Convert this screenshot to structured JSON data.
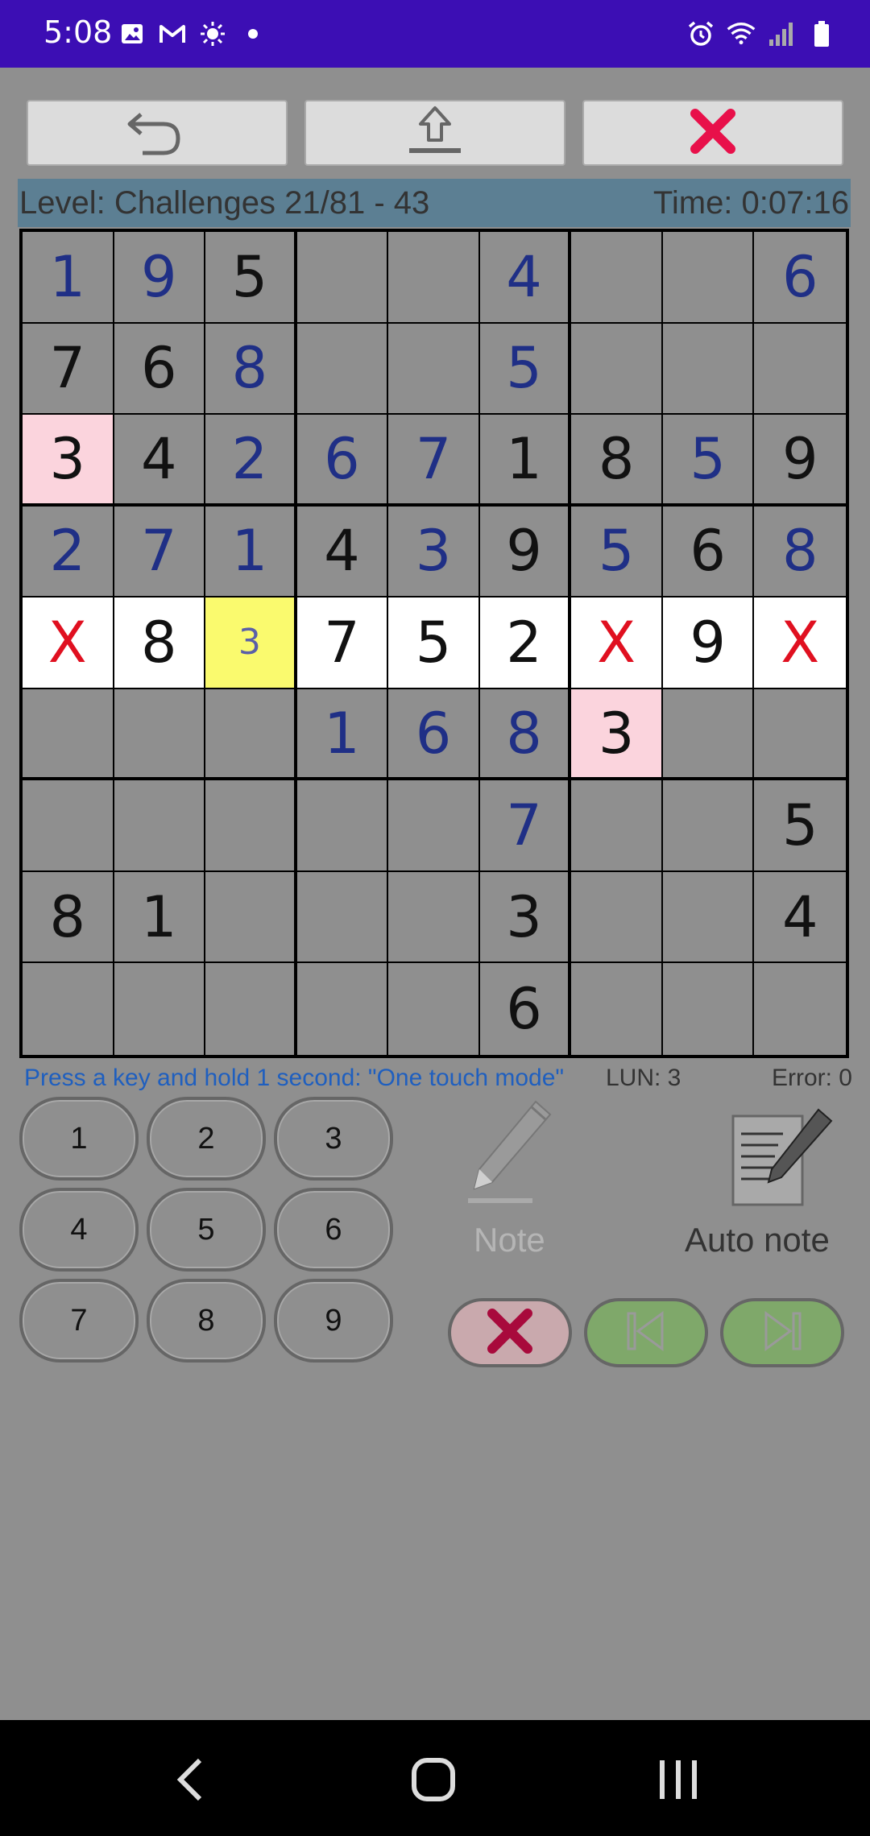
{
  "status_bar": {
    "time": "5:08"
  },
  "info": {
    "level": "Level: Challenges 21/81 - 43",
    "time": "Time: 0:07:16"
  },
  "grid": [
    [
      "1",
      "9",
      "5",
      "",
      "",
      "4",
      "",
      "",
      "6"
    ],
    [
      "7",
      "6",
      "8",
      "",
      "",
      "5",
      "",
      "",
      ""
    ],
    [
      "3",
      "4",
      "2",
      "6",
      "7",
      "1",
      "8",
      "5",
      "9"
    ],
    [
      "2",
      "7",
      "1",
      "4",
      "3",
      "9",
      "5",
      "6",
      "8"
    ],
    [
      "X",
      "8",
      "3",
      "7",
      "5",
      "2",
      "X",
      "9",
      "X"
    ],
    [
      "",
      "",
      "",
      "1",
      "6",
      "8",
      "3",
      "",
      ""
    ],
    [
      "",
      "",
      "",
      "",
      "",
      "7",
      "",
      "",
      "5"
    ],
    [
      "8",
      "1",
      "",
      "",
      "",
      "3",
      "",
      "",
      "4"
    ],
    [
      "",
      "",
      "",
      "",
      "",
      "6",
      "",
      "",
      ""
    ]
  ],
  "hint": {
    "text": "Press a key and hold 1 second: \"One touch mode\"",
    "lun": "LUN: 3",
    "error": "Error: 0"
  },
  "keypad": [
    "1",
    "2",
    "3",
    "4",
    "5",
    "6",
    "7",
    "8",
    "9"
  ],
  "tools": {
    "note_label": "Note",
    "autonote_label": "Auto note"
  },
  "colors": {
    "status_bar": "#3c0eb4",
    "background": "#8f8f8f",
    "info_bar": "#5c7f93",
    "user_digit": "#1f2f86",
    "error_mark": "#e01020",
    "highlight_pink": "#fbd4dd",
    "highlight_yellow": "#fafa6e"
  }
}
